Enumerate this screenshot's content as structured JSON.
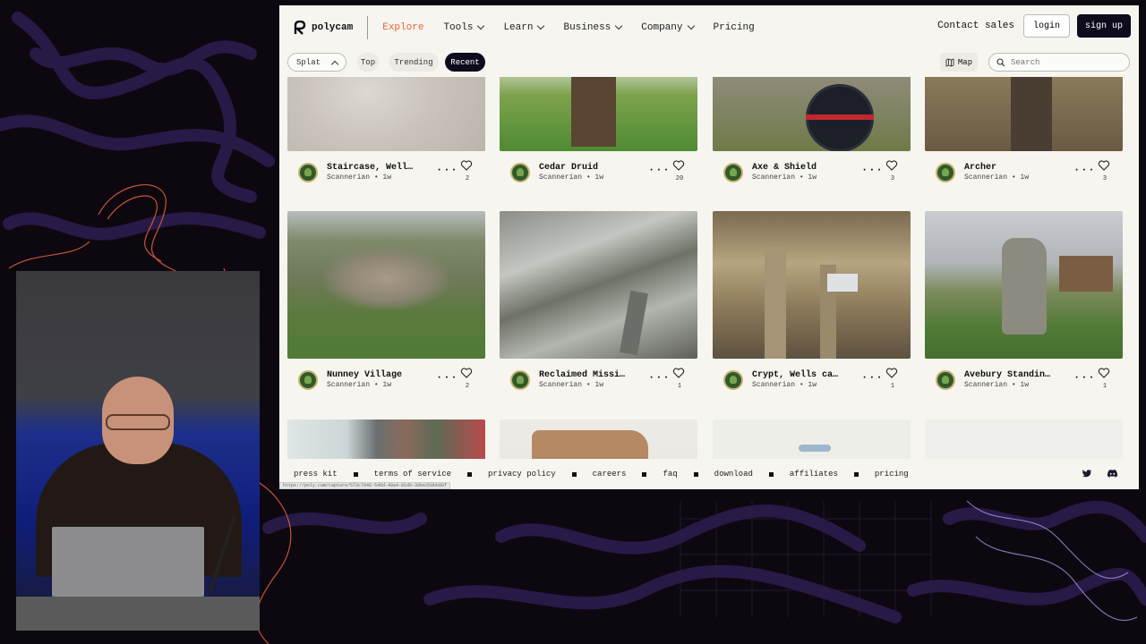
{
  "brand": {
    "name": "polycam"
  },
  "nav": {
    "items": [
      {
        "label": "Explore",
        "active": true,
        "dropdown": false
      },
      {
        "label": "Tools",
        "active": false,
        "dropdown": true
      },
      {
        "label": "Learn",
        "active": false,
        "dropdown": true
      },
      {
        "label": "Business",
        "active": false,
        "dropdown": true
      },
      {
        "label": "Company",
        "active": false,
        "dropdown": true
      },
      {
        "label": "Pricing",
        "active": false,
        "dropdown": false
      }
    ],
    "contact_sales": "Contact sales",
    "login": "login",
    "signup": "sign up"
  },
  "filters": {
    "select_value": "Splat",
    "tabs": [
      "Top",
      "Trending",
      "Recent"
    ],
    "active_tab": "Recent",
    "map_label": "Map",
    "search_placeholder": "Search"
  },
  "cards": [
    {
      "title": "Staircase, Well…",
      "author": "Scannerian",
      "age": "1w",
      "likes": "2"
    },
    {
      "title": "Cedar Druid",
      "author": "Scannerian",
      "age": "1w",
      "likes": "20"
    },
    {
      "title": "Axe & Shield",
      "author": "Scannerian",
      "age": "1w",
      "likes": "3"
    },
    {
      "title": "Archer",
      "author": "Scannerian",
      "age": "1w",
      "likes": "3"
    },
    {
      "title": "Nunney Village",
      "author": "Scannerian",
      "age": "1w",
      "likes": "2"
    },
    {
      "title": "Reclaimed Missi…",
      "author": "Scannerian",
      "age": "1w",
      "likes": "1"
    },
    {
      "title": "Crypt, Wells ca…",
      "author": "Scannerian",
      "age": "1w",
      "likes": "1"
    },
    {
      "title": "Avebury Standin…",
      "author": "Scannerian",
      "age": "1w",
      "likes": "1"
    }
  ],
  "footer": {
    "links": [
      "press kit",
      "terms of service",
      "privacy policy",
      "careers",
      "faq",
      "download",
      "affiliates",
      "pricing"
    ],
    "icons": [
      "twitter-icon",
      "discord-icon"
    ]
  },
  "status_url": "https://poly.cam/capture/573c7046-546d-40a4-81d9-39be358bb88f",
  "colors": {
    "accent": "#e8623c",
    "dark": "#0e0b1c",
    "page_bg": "#f6f5f0",
    "stage_bg": "#0d0810"
  }
}
